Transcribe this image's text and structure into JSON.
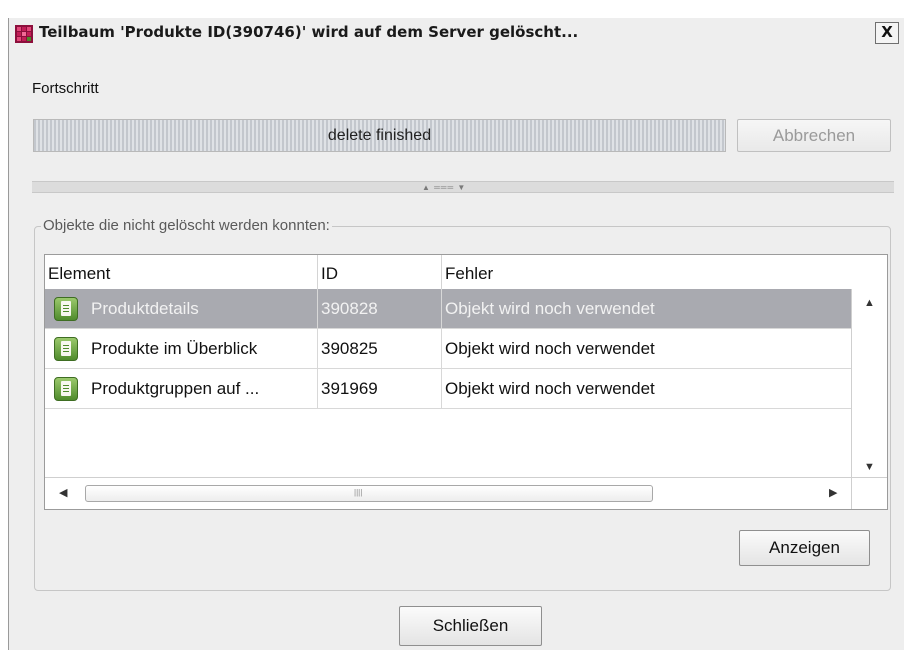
{
  "window": {
    "title": "Teilbaum 'Produkte ID(390746)' wird auf dem Server gelöscht...",
    "close_label": "X"
  },
  "progress": {
    "label": "Fortschritt",
    "status_text": "delete finished",
    "fraction": 1.0,
    "cancel_label": "Abbrechen",
    "cancel_enabled": false
  },
  "failed_objects": {
    "group_title": "Objekte die nicht gelöscht werden konnten:",
    "columns": [
      "Element",
      "ID",
      "Fehler"
    ],
    "rows": [
      {
        "element": "Produktdetails",
        "id": "390828",
        "error": "Objekt wird noch verwendet",
        "selected": true,
        "icon": "document-icon"
      },
      {
        "element": "Produkte im Überblick",
        "id": "390825",
        "error": "Objekt wird noch verwendet",
        "selected": false,
        "icon": "document-icon"
      },
      {
        "element": "Produktgruppen auf ...",
        "id": "391969",
        "error": "Objekt wird noch verwendet",
        "selected": false,
        "icon": "document-icon"
      }
    ],
    "show_label": "Anzeigen"
  },
  "footer": {
    "close_label": "Schließen"
  },
  "colors": {
    "dialog_bg": "#eeeeee",
    "selected_row": "#a9aab0",
    "icon_green": "#4f8b2c",
    "app_icon_red": "#b0144a"
  }
}
